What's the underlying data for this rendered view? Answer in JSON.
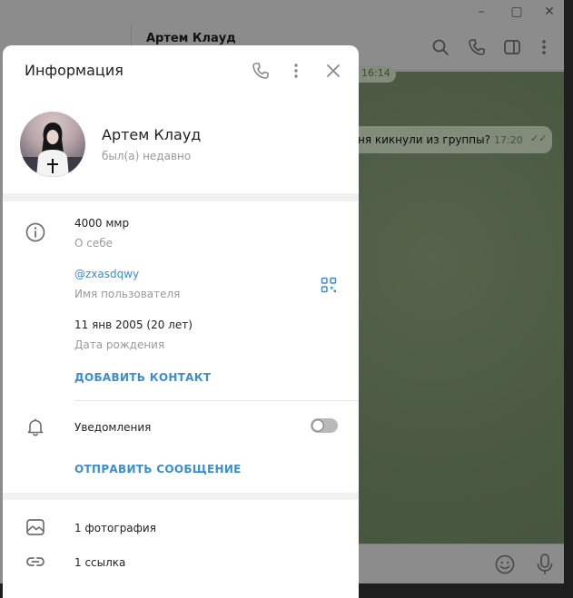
{
  "background": {
    "chat_title": "Артем Клауд",
    "date_chip": "ня",
    "message_text": "ня кикнули из группы?",
    "message_time": "17:20",
    "earlier_time": "16:14"
  },
  "panel": {
    "title": "Информация",
    "profile": {
      "name": "Артем Клауд",
      "status": "был(а) недавно"
    },
    "info": {
      "bio_value": "4000 ммр",
      "bio_label": "О себе",
      "username_value": "@zxasdqwy",
      "username_label": "Имя пользователя",
      "birthday_value": "11 янв 2005 (20 лет)",
      "birthday_label": "Дата рождения",
      "add_contact": "ДОБАВИТЬ КОНТАКТ",
      "notifications_label": "Уведомления",
      "notifications_on": false,
      "send_message": "ОТПРАВИТЬ СООБЩЕНИЕ"
    },
    "media": {
      "photos": "1 фотография",
      "links": "1 ссылка"
    }
  },
  "colors": {
    "accent": "#3a8ed1",
    "secondary_text": "#9a9a9a"
  }
}
